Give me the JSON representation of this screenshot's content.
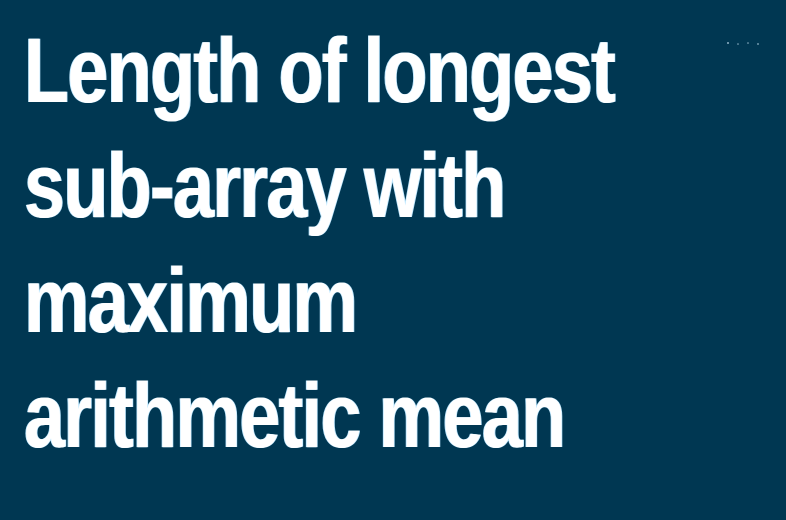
{
  "banner": {
    "title_lines": [
      "Length of longest",
      "sub-array with",
      "maximum",
      "arithmetic mean"
    ],
    "colors": {
      "background": "#003752",
      "text": "#ffffff"
    }
  }
}
